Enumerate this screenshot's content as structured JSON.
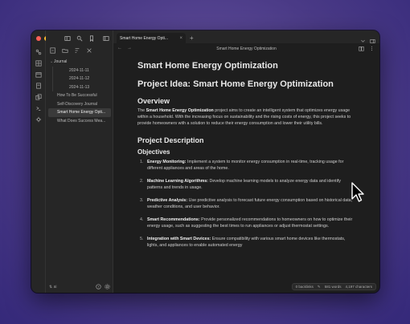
{
  "colors": {
    "close": "#ff5f57",
    "minimize": "#febc2e",
    "zoom": "#28c840",
    "active_file_bg": "#3a3a3a"
  },
  "ribbon": {
    "icons": [
      "graph-icon",
      "grid-icon",
      "calendar-icon",
      "template-icon",
      "copy-icon",
      "terminal-icon",
      "settings-share-icon"
    ]
  },
  "sidebar": {
    "toolbar_icons": [
      "new-note-icon",
      "new-folder-icon",
      "sort-icon",
      "collapse-icon"
    ],
    "folder": "Journal",
    "dated_items": [
      "2024-11-11",
      "2024-11-12",
      "2024-11-13"
    ],
    "files": [
      "How To Be Successful",
      "Self-Discovery Journal",
      "Smart Home Energy Opti...",
      "What Does Success Mea..."
    ],
    "footer_vault": "ai"
  },
  "tabbar": {
    "tab_label": "Smart Home Energy Opti...",
    "close": "×",
    "add": "+"
  },
  "viewhead": {
    "title": "Smart Home Energy Optimization",
    "back": "←",
    "forward": "→"
  },
  "document": {
    "title": "Smart Home Energy Optimization",
    "idea_heading": "Project Idea: Smart Home Energy Optimization",
    "overview_heading": "Overview",
    "overview_pre": "The ",
    "overview_bold": "Smart Home Energy Optimization",
    "overview_post": " project aims to create an intelligent system that optimizes energy usage within a household. With the increasing focus on sustainability and the rising costs of energy, this project seeks to provide homeowners with a solution to reduce their energy consumption and lower their utility bills.",
    "description_heading": "Project Description",
    "objectives_heading": "Objectives",
    "objectives": [
      {
        "num": "1.",
        "title": "Energy Monitoring:",
        "text": " Implement a system to monitor energy consumption in real-time, tracking usage for different appliances and areas of the home."
      },
      {
        "num": "2.",
        "title": "Machine Learning Algorithms:",
        "text": " Develop machine learning models to analyze energy data and identify patterns and trends in usage."
      },
      {
        "num": "3.",
        "title": "Predictive Analysis:",
        "text": " Use predictive analysis to forecast future energy consumption based on historical data, weather conditions, and user behavior."
      },
      {
        "num": "4.",
        "title": "Smart Recommendations:",
        "text": " Provide personalized recommendations to homeowners on how to optimize their energy usage, such as suggesting the best times to run appliances or adjust thermostat settings."
      },
      {
        "num": "5.",
        "title": "Integration with Smart Devices:",
        "text": " Ensure compatibility with various smart home devices like thermostats, lights, and appliances to enable automated energy"
      }
    ]
  },
  "status": {
    "backlinks": "0 backlinks",
    "words": "581 words",
    "characters": "4,197 characters"
  }
}
